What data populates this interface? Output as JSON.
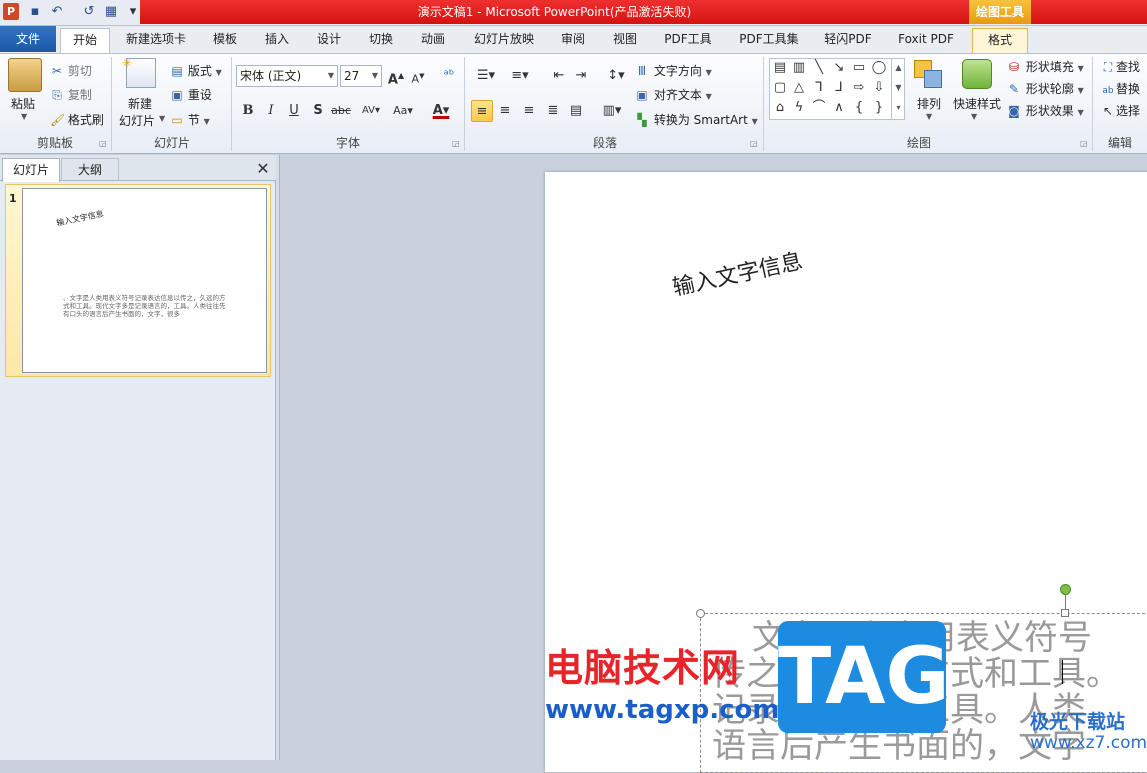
{
  "window": {
    "title": "演示文稿1 - Microsoft PowerPoint(产品激活失败)",
    "context_tab_group": "绘图工具"
  },
  "tabs": [
    "文件",
    "开始",
    "新建选项卡",
    "模板",
    "插入",
    "设计",
    "切换",
    "动画",
    "幻灯片放映",
    "审阅",
    "视图",
    "PDF工具",
    "PDF工具集",
    "轻闪PDF",
    "Foxit PDF",
    "格式"
  ],
  "clipboard": {
    "paste": "粘贴",
    "cut": "剪切",
    "copy": "复制",
    "format_painter": "格式刷",
    "label": "剪贴板"
  },
  "slides_group": {
    "new_slide_1": "新建",
    "new_slide_2": "幻灯片",
    "layout": "版式",
    "reset": "重设",
    "section": "节",
    "label": "幻灯片"
  },
  "font": {
    "name": "宋体 (正文)",
    "size": "27",
    "label": "字体"
  },
  "paragraph": {
    "text_direction": "文字方向",
    "align_text": "对齐文本",
    "convert_smartart": "转换为 SmartArt",
    "label": "段落"
  },
  "drawing": {
    "arrange": "排列",
    "quick_styles": "快速样式",
    "shape_fill": "形状填充",
    "shape_outline": "形状轮廓",
    "shape_effects": "形状效果",
    "label": "绘图"
  },
  "editing": {
    "find": "查找",
    "replace": "替换",
    "select": "选择",
    "label": "编辑"
  },
  "left_pane": {
    "tab_slides": "幻灯片",
    "tab_outline": "大纲",
    "slide_number": "1"
  },
  "thumbnail": {
    "title": "输入文字信息",
    "body": "、文字是人类用表义符号记录表达信息以传之，久远的方式和工具。现代文字多是记录语言的，工具。人类往往先有口头的语言后产生书面的，文字，很多"
  },
  "slide": {
    "title": "输入文字信息",
    "body_lines": [
      "文字是人类用表义符号",
      "传之，久远的方式和工具。",
      "记录语言的，工具。人类",
      "语言后产生书面的，文字"
    ]
  },
  "watermark": {
    "cn": "电脑技术网",
    "url": "www.tagxp.com",
    "tag": "TAG",
    "jg": "极光下载站",
    "jg_url": "www.xz7.com"
  },
  "colors": {
    "title_bar": "#e21c1c",
    "context_tab": "#f0b030",
    "file_tab": "#2a6bbf",
    "workspace": "#c9d1dd"
  }
}
